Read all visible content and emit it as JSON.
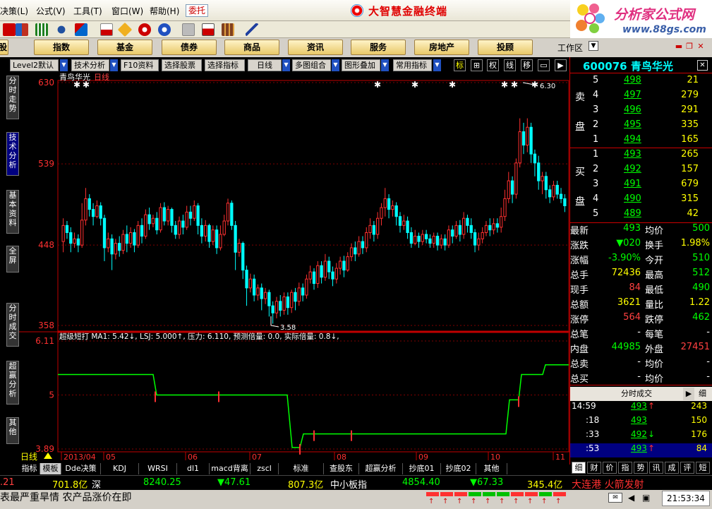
{
  "menu": [
    "决策(L)",
    "公式(V)",
    "工具(T)",
    "窗口(W)",
    "帮助(H)"
  ],
  "entrust": "委托",
  "brand": "大智慧金融终端",
  "ad": {
    "line1": "分析家公式网",
    "line2": "www.88gs.com"
  },
  "nav": [
    "股",
    "指数",
    "基金",
    "债券",
    "商品",
    "资讯",
    "服务",
    "房地产",
    "投顾"
  ],
  "workarea": "工作区",
  "chart_toolbar": {
    "items": [
      "Level2默认",
      "技术分析",
      "F10资料",
      "选择股票",
      "选择指标",
      "日线",
      "多图组合",
      "图形叠加",
      "常用指标"
    ],
    "icons": [
      "标",
      "⊞",
      "权",
      "线",
      "移",
      "▭",
      "▶"
    ]
  },
  "sidetabs": [
    "分时走势",
    "技术分析",
    "基本资料",
    "全屏",
    "分时成交",
    "超赢分析",
    "其他"
  ],
  "chart_data": [
    {
      "type": "candlestick",
      "title": "青鸟华光",
      "period": "日线",
      "yticks": [
        630,
        539,
        448,
        358
      ],
      "ylim": [
        358,
        630
      ],
      "low_label": "3.58",
      "high_label": "6.30",
      "candles_approx": [
        [
          452,
          470,
          440,
          478
        ],
        [
          470,
          462,
          455,
          475
        ],
        [
          462,
          450,
          440,
          468
        ],
        [
          450,
          455,
          445,
          462
        ],
        [
          455,
          448,
          440,
          460
        ],
        [
          448,
          476,
          445,
          495
        ],
        [
          476,
          500,
          470,
          512
        ],
        [
          500,
          488,
          480,
          505
        ],
        [
          488,
          480,
          470,
          495
        ],
        [
          480,
          492,
          478,
          498
        ],
        [
          492,
          478,
          470,
          496
        ],
        [
          478,
          445,
          430,
          482
        ],
        [
          445,
          455,
          440,
          462
        ],
        [
          455,
          438,
          420,
          460
        ],
        [
          438,
          450,
          432,
          455
        ],
        [
          450,
          442,
          435,
          458
        ],
        [
          442,
          460,
          438,
          465
        ],
        [
          460,
          450,
          440,
          470
        ],
        [
          450,
          462,
          445,
          468
        ],
        [
          462,
          448,
          440,
          466
        ],
        [
          448,
          470,
          445,
          475
        ],
        [
          470,
          458,
          450,
          478
        ],
        [
          458,
          482,
          455,
          488
        ],
        [
          482,
          472,
          465,
          490
        ],
        [
          472,
          478,
          468,
          482
        ],
        [
          478,
          465,
          460,
          485
        ],
        [
          465,
          490,
          462,
          495
        ],
        [
          490,
          475,
          470,
          496
        ],
        [
          475,
          488,
          470,
          492
        ],
        [
          488,
          470,
          462,
          490
        ],
        [
          470,
          460,
          455,
          475
        ],
        [
          460,
          475,
          455,
          480
        ],
        [
          475,
          468,
          460,
          482
        ],
        [
          468,
          485,
          465,
          492
        ],
        [
          485,
          478,
          470,
          492
        ],
        [
          478,
          492,
          475,
          498
        ],
        [
          492,
          470,
          460,
          495
        ],
        [
          470,
          458,
          450,
          478
        ],
        [
          458,
          470,
          452,
          476
        ],
        [
          470,
          452,
          445,
          472
        ],
        [
          452,
          465,
          448,
          470
        ],
        [
          465,
          445,
          438,
          470
        ],
        [
          445,
          460,
          442,
          470
        ],
        [
          460,
          475,
          458,
          482
        ],
        [
          475,
          495,
          470,
          500
        ],
        [
          495,
          470,
          465,
          498
        ],
        [
          470,
          440,
          420,
          475
        ],
        [
          440,
          450,
          435,
          455
        ],
        [
          450,
          420,
          410,
          452
        ],
        [
          420,
          400,
          380,
          425
        ],
        [
          400,
          410,
          395,
          416
        ],
        [
          410,
          392,
          385,
          415
        ],
        [
          392,
          400,
          386,
          404
        ],
        [
          400,
          388,
          375,
          405
        ],
        [
          388,
          395,
          382,
          400
        ],
        [
          395,
          380,
          368,
          398
        ],
        [
          380,
          372,
          360,
          385
        ],
        [
          372,
          385,
          366,
          390
        ],
        [
          385,
          375,
          368,
          392
        ],
        [
          375,
          390,
          370,
          395
        ],
        [
          390,
          378,
          370,
          395
        ],
        [
          378,
          395,
          372,
          398
        ],
        [
          395,
          385,
          375,
          400
        ],
        [
          385,
          400,
          380,
          406
        ],
        [
          400,
          392,
          385,
          405
        ],
        [
          392,
          410,
          388,
          415
        ],
        [
          410,
          418,
          405,
          425
        ],
        [
          418,
          405,
          398,
          422
        ],
        [
          405,
          425,
          400,
          430
        ],
        [
          425,
          412,
          405,
          430
        ],
        [
          412,
          430,
          408,
          438
        ],
        [
          430,
          418,
          410,
          435
        ],
        [
          418,
          410,
          402,
          424
        ],
        [
          410,
          422,
          405,
          428
        ],
        [
          422,
          430,
          415,
          435
        ],
        [
          430,
          420,
          412,
          436
        ],
        [
          420,
          435,
          418,
          440
        ],
        [
          435,
          445,
          430,
          450
        ],
        [
          445,
          438,
          430,
          452
        ],
        [
          438,
          452,
          435,
          458
        ],
        [
          452,
          445,
          438,
          458
        ],
        [
          445,
          462,
          440,
          468
        ],
        [
          462,
          470,
          455,
          478
        ],
        [
          470,
          460,
          452,
          475
        ],
        [
          460,
          478,
          455,
          485
        ],
        [
          478,
          490,
          470,
          495
        ],
        [
          490,
          500,
          480,
          512
        ],
        [
          500,
          488,
          478,
          505
        ],
        [
          488,
          492,
          480,
          498
        ],
        [
          492,
          480,
          470,
          496
        ],
        [
          480,
          470,
          462,
          485
        ],
        [
          470,
          475,
          465,
          482
        ],
        [
          475,
          462,
          455,
          480
        ],
        [
          462,
          450,
          445,
          468
        ],
        [
          450,
          458,
          448,
          465
        ],
        [
          458,
          452,
          445,
          462
        ],
        [
          452,
          460,
          448,
          465
        ],
        [
          460,
          455,
          450,
          465
        ],
        [
          455,
          450,
          445,
          460
        ],
        [
          450,
          458,
          445,
          462
        ],
        [
          458,
          448,
          442,
          462
        ],
        [
          448,
          455,
          444,
          460
        ],
        [
          455,
          448,
          442,
          460
        ],
        [
          448,
          465,
          445,
          470
        ],
        [
          465,
          458,
          450,
          470
        ],
        [
          458,
          470,
          455,
          475
        ],
        [
          470,
          460,
          452,
          476
        ],
        [
          460,
          478,
          455,
          485
        ],
        [
          478,
          470,
          462,
          482
        ],
        [
          470,
          462,
          455,
          478
        ],
        [
          462,
          448,
          440,
          466
        ],
        [
          448,
          455,
          442,
          462
        ],
        [
          455,
          462,
          450,
          468
        ],
        [
          462,
          470,
          458,
          475
        ],
        [
          470,
          465,
          458,
          478
        ],
        [
          465,
          472,
          460,
          478
        ],
        [
          472,
          468,
          462,
          478
        ],
        [
          468,
          480,
          462,
          490
        ],
        [
          480,
          500,
          475,
          510
        ],
        [
          500,
          520,
          495,
          530
        ],
        [
          520,
          505,
          495,
          525
        ],
        [
          505,
          540,
          500,
          545
        ],
        [
          540,
          575,
          535,
          590
        ],
        [
          575,
          560,
          550,
          585
        ],
        [
          560,
          580,
          552,
          590
        ],
        [
          580,
          550,
          540,
          585
        ],
        [
          550,
          540,
          525,
          555
        ],
        [
          540,
          520,
          510,
          548
        ],
        [
          520,
          525,
          505,
          530
        ],
        [
          525,
          510,
          500,
          530
        ],
        [
          510,
          502,
          495,
          515
        ],
        [
          502,
          515,
          498,
          520
        ],
        [
          515,
          505,
          500,
          520
        ],
        [
          505,
          500,
          495,
          512
        ],
        [
          500,
          492,
          485,
          505
        ]
      ]
    },
    {
      "type": "line",
      "name": "超级短打",
      "legend": "超级短打  MA1: 5.42↓, LSJ: 5.000↑, 压力: 6.110, 预测倍量: 0.0, 实际倍量: 0.8↓,",
      "yticks": [
        6.11,
        5.0,
        3.89
      ],
      "ylim": [
        3.89,
        6.11
      ]
    }
  ],
  "xaxis": [
    "2013/04",
    "05",
    "06",
    "07",
    "08",
    "09",
    "10",
    "11"
  ],
  "period_label": "日线",
  "right_panel": {
    "code": "600076 青鸟华光",
    "sell_label": [
      "卖",
      "盘"
    ],
    "buy_label": [
      "买",
      "盘"
    ],
    "sell": [
      {
        "lvl": "5",
        "price": "498",
        "vol": "21"
      },
      {
        "lvl": "4",
        "price": "497",
        "vol": "279"
      },
      {
        "lvl": "3",
        "price": "496",
        "vol": "291"
      },
      {
        "lvl": "2",
        "price": "495",
        "vol": "335"
      },
      {
        "lvl": "1",
        "price": "494",
        "vol": "165"
      }
    ],
    "buy": [
      {
        "lvl": "1",
        "price": "493",
        "vol": "265"
      },
      {
        "lvl": "2",
        "price": "492",
        "vol": "157"
      },
      {
        "lvl": "3",
        "price": "491",
        "vol": "679"
      },
      {
        "lvl": "4",
        "price": "490",
        "vol": "315"
      },
      {
        "lvl": "5",
        "price": "489",
        "vol": "42"
      }
    ],
    "quotes": [
      {
        "l1": "最新",
        "v1": "493",
        "l2": "均价",
        "v2": "500"
      },
      {
        "l1": "涨跌",
        "v1": "▼020",
        "l2": "换手",
        "v2": "1.98%"
      },
      {
        "l1": "涨幅",
        "v1": "-3.90%",
        "l2": "今开",
        "v2": "510"
      },
      {
        "l1": "总手",
        "v1": "72436",
        "l2": "最高",
        "v2": "512"
      },
      {
        "l1": "现手",
        "v1": "84",
        "l2": "最低",
        "v2": "490"
      },
      {
        "l1": "总额",
        "v1": "3621",
        "l2": "量比",
        "v2": "1.22"
      },
      {
        "l1": "涨停",
        "v1": "564",
        "l2": "跌停",
        "v2": "462"
      },
      {
        "l1": "总笔",
        "v1": "-",
        "l2": "每笔",
        "v2": "-"
      },
      {
        "l1": "内盘",
        "v1": "44985",
        "l2": "外盘",
        "v2": "27451"
      },
      {
        "l1": "总卖",
        "v1": "-",
        "l2": "均价",
        "v2": "-"
      },
      {
        "l1": "总买",
        "v1": "-",
        "l2": "均价",
        "v2": "-"
      }
    ],
    "ticks_header": "分时成交",
    "ticks_more": "细",
    "ticks": [
      {
        "t": "14:59",
        "p": "493",
        "a": "↑",
        "v": "243"
      },
      {
        "t": ":18",
        "p": "493",
        "a": "",
        "v": "150"
      },
      {
        "t": ":33",
        "p": "492",
        "a": "↓",
        "v": "176"
      },
      {
        "t": ":53",
        "p": "493",
        "a": "↑",
        "v": "84"
      }
    ],
    "tabs": [
      "细",
      "财",
      "价",
      "指",
      "势",
      "讯",
      "成",
      "评",
      "短"
    ]
  },
  "bottom_tabs": [
    "指标",
    "模板",
    "Dde决策",
    "KDJ",
    "WRSI",
    "dl1",
    "macd背离",
    "zscl",
    "标准",
    "查股东",
    "超赢分析",
    "抄底01",
    "抄底02",
    "其他"
  ],
  "status": [
    ".21",
    "701.8亿",
    "深",
    "8240.25",
    "▼47.61",
    "807.3亿",
    "中小板指",
    "4854.40",
    "▼67.33",
    "345.4亿"
  ],
  "ticker": {
    "alert": "大连港   火箭发射",
    "news": "表最严重旱情 农产品涨价在即",
    "clock": "21:53:34"
  },
  "colors": {
    "up": "#ff3030",
    "down": "#00ffff",
    "indicator": "#00ff00",
    "accent": "#ffff00"
  }
}
